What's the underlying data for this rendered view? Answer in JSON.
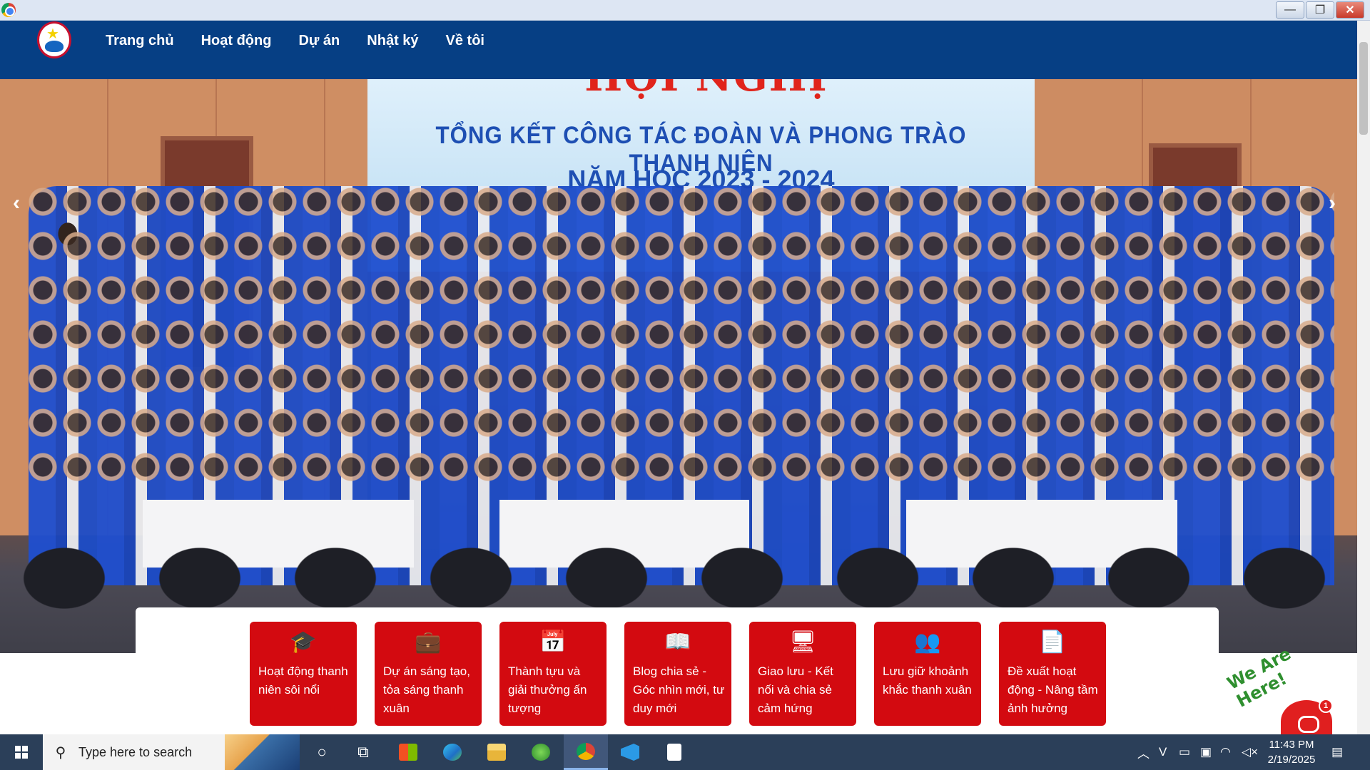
{
  "nav": {
    "items": [
      "Trang chủ",
      "Hoạt động",
      "Dự án",
      "Nhật ký",
      "Về tôi"
    ]
  },
  "hero": {
    "banner_heading": "HỘI NGHỊ",
    "banner_line1": "TỔNG KẾT CÔNG TÁC ĐOÀN VÀ PHONG TRÀO THANH NIÊN",
    "banner_line2": "NĂM HỌC 2023 - 2024",
    "prev_arrow": "‹",
    "next_arrow": "›"
  },
  "categories": [
    {
      "icon": "graduation-cap-icon",
      "glyph": "🎓",
      "label": "Hoạt động thanh niên sôi nổi"
    },
    {
      "icon": "briefcase-icon",
      "glyph": "💼",
      "label": "Dự án sáng tạo, tỏa sáng thanh xuân"
    },
    {
      "icon": "calendar-icon",
      "glyph": "📅",
      "label": "Thành tựu và giải thưởng ấn tượng"
    },
    {
      "icon": "book-icon",
      "glyph": "📖",
      "label": "Blog chia sẻ - Góc nhìn mới, tư duy mới"
    },
    {
      "icon": "monitor-icon",
      "glyph": "🖥",
      "label": "Giao lưu - Kết nối và chia sẻ cảm hứng"
    },
    {
      "icon": "users-icon",
      "glyph": "👥",
      "label": "Lưu giữ khoảnh khắc thanh xuân"
    },
    {
      "icon": "document-icon",
      "glyph": "📄",
      "label": "Đề xuất hoạt động - Nâng tầm ảnh hưởng"
    }
  ],
  "chat": {
    "tagline": "We Are Here!",
    "badge_count": "1"
  },
  "taskbar": {
    "search_placeholder": "Type here to search",
    "time": "11:43 PM",
    "date": "2/19/2025"
  },
  "colors": {
    "nav_bg": "#063f84",
    "card_red": "#d30a10",
    "taskbar_bg": "#2b3f59"
  }
}
